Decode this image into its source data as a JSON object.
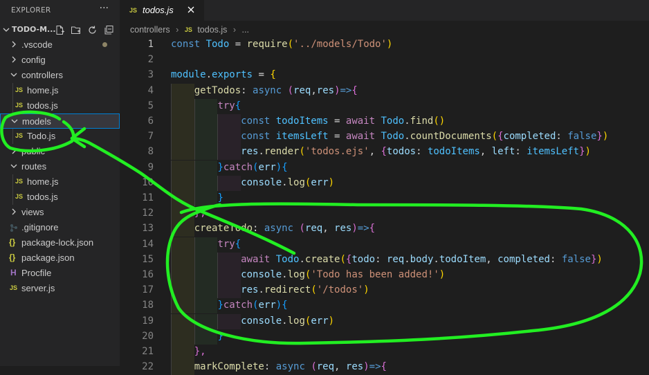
{
  "sidebar": {
    "title": "EXPLORER",
    "more_glyph": "···",
    "workspace": "TODO-M...",
    "tree": [
      {
        "label": ".vscode",
        "kind": "folder",
        "expanded": false,
        "modified_dot": true
      },
      {
        "label": "config",
        "kind": "folder",
        "expanded": false
      },
      {
        "label": "controllers",
        "kind": "folder",
        "expanded": true
      },
      {
        "label": "home.js",
        "kind": "js"
      },
      {
        "label": "todos.js",
        "kind": "js"
      },
      {
        "label": "models",
        "kind": "folder",
        "expanded": true,
        "selected": true
      },
      {
        "label": "Todo.js",
        "kind": "js"
      },
      {
        "label": "public",
        "kind": "folder",
        "expanded": false
      },
      {
        "label": "routes",
        "kind": "folder",
        "expanded": true
      },
      {
        "label": "home.js",
        "kind": "js"
      },
      {
        "label": "todos.js",
        "kind": "js"
      },
      {
        "label": "views",
        "kind": "folder",
        "expanded": false
      },
      {
        "label": ".gitignore",
        "kind": "gitignore"
      },
      {
        "label": "package-lock.json",
        "kind": "json"
      },
      {
        "label": "package.json",
        "kind": "json"
      },
      {
        "label": "Procfile",
        "kind": "procfile"
      },
      {
        "label": "server.js",
        "kind": "js"
      }
    ]
  },
  "editor": {
    "tab": {
      "icon_text": "JS",
      "label": "todos.js"
    },
    "breadcrumb": {
      "folder": "controllers",
      "file": "todos.js",
      "tail": "..."
    },
    "lines": [
      {
        "n": "1",
        "tokens": [
          [
            "const ",
            "kw"
          ],
          [
            "Todo",
            "var"
          ],
          [
            " = ",
            "pl"
          ],
          [
            "require",
            "fn"
          ],
          [
            "(",
            "br1"
          ],
          [
            "'../models/Todo'",
            "str"
          ],
          [
            ")",
            "br1"
          ]
        ]
      },
      {
        "n": "2",
        "tokens": []
      },
      {
        "n": "3",
        "tokens": [
          [
            "module",
            "var"
          ],
          [
            ".",
            "pl"
          ],
          [
            "exports",
            "var"
          ],
          [
            " = ",
            "pl"
          ],
          [
            "{",
            "br1"
          ]
        ]
      },
      {
        "n": "4",
        "tokens": [
          [
            "    ",
            "pl"
          ],
          [
            "getTodos",
            "fn"
          ],
          [
            ": ",
            "pl"
          ],
          [
            "async ",
            "kw"
          ],
          [
            "(",
            "br2"
          ],
          [
            "req",
            "prop"
          ],
          [
            ",",
            "pl"
          ],
          [
            "res",
            "prop"
          ],
          [
            ")",
            "br2"
          ],
          [
            "=>",
            "kw"
          ],
          [
            "{",
            "br2"
          ]
        ]
      },
      {
        "n": "5",
        "tokens": [
          [
            "        ",
            "pl"
          ],
          [
            "try",
            "ctl"
          ],
          [
            "{",
            "br3"
          ]
        ]
      },
      {
        "n": "6",
        "tokens": [
          [
            "            ",
            "pl"
          ],
          [
            "const ",
            "kw"
          ],
          [
            "todoItems",
            "var"
          ],
          [
            " = ",
            "pl"
          ],
          [
            "await ",
            "ctl"
          ],
          [
            "Todo",
            "var"
          ],
          [
            ".",
            "pl"
          ],
          [
            "find",
            "fn"
          ],
          [
            "()",
            "br1"
          ]
        ]
      },
      {
        "n": "7",
        "tokens": [
          [
            "            ",
            "pl"
          ],
          [
            "const ",
            "kw"
          ],
          [
            "itemsLeft",
            "var"
          ],
          [
            " = ",
            "pl"
          ],
          [
            "await ",
            "ctl"
          ],
          [
            "Todo",
            "var"
          ],
          [
            ".",
            "pl"
          ],
          [
            "countDocuments",
            "fn"
          ],
          [
            "(",
            "br1"
          ],
          [
            "{",
            "br2"
          ],
          [
            "completed",
            "prop"
          ],
          [
            ": ",
            "pl"
          ],
          [
            "false",
            "kw"
          ],
          [
            "}",
            "br2"
          ],
          [
            ")",
            "br1"
          ]
        ]
      },
      {
        "n": "8",
        "tokens": [
          [
            "            ",
            "pl"
          ],
          [
            "res",
            "prop"
          ],
          [
            ".",
            "pl"
          ],
          [
            "render",
            "fn"
          ],
          [
            "(",
            "br1"
          ],
          [
            "'todos.ejs'",
            "str"
          ],
          [
            ", ",
            "pl"
          ],
          [
            "{",
            "br2"
          ],
          [
            "todos",
            "prop"
          ],
          [
            ": ",
            "pl"
          ],
          [
            "todoItems",
            "var"
          ],
          [
            ", ",
            "pl"
          ],
          [
            "left",
            "prop"
          ],
          [
            ": ",
            "pl"
          ],
          [
            "itemsLeft",
            "var"
          ],
          [
            "}",
            "br2"
          ],
          [
            ")",
            "br1"
          ]
        ]
      },
      {
        "n": "9",
        "tokens": [
          [
            "        ",
            "pl"
          ],
          [
            "}",
            "br3"
          ],
          [
            "catch",
            "ctl"
          ],
          [
            "(",
            "br3"
          ],
          [
            "err",
            "prop"
          ],
          [
            ")",
            "br3"
          ],
          [
            "{",
            "br3"
          ]
        ]
      },
      {
        "n": "10",
        "tokens": [
          [
            "            ",
            "pl"
          ],
          [
            "console",
            "prop"
          ],
          [
            ".",
            "pl"
          ],
          [
            "log",
            "fn"
          ],
          [
            "(",
            "br1"
          ],
          [
            "err",
            "prop"
          ],
          [
            ")",
            "br1"
          ]
        ]
      },
      {
        "n": "11",
        "tokens": [
          [
            "        ",
            "pl"
          ],
          [
            "}",
            "br3"
          ]
        ]
      },
      {
        "n": "12",
        "tokens": [
          [
            "    ",
            "pl"
          ],
          [
            "},",
            "br2"
          ]
        ]
      },
      {
        "n": "13",
        "tokens": [
          [
            "    ",
            "pl"
          ],
          [
            "createTodo",
            "fn"
          ],
          [
            ": ",
            "pl"
          ],
          [
            "async ",
            "kw"
          ],
          [
            "(",
            "br2"
          ],
          [
            "req",
            "prop"
          ],
          [
            ", ",
            "pl"
          ],
          [
            "res",
            "prop"
          ],
          [
            ")",
            "br2"
          ],
          [
            "=>",
            "kw"
          ],
          [
            "{",
            "br2"
          ]
        ]
      },
      {
        "n": "14",
        "tokens": [
          [
            "        ",
            "pl"
          ],
          [
            "try",
            "ctl"
          ],
          [
            "{",
            "br3"
          ]
        ]
      },
      {
        "n": "15",
        "tokens": [
          [
            "            ",
            "pl"
          ],
          [
            "await ",
            "ctl"
          ],
          [
            "Todo",
            "var"
          ],
          [
            ".",
            "pl"
          ],
          [
            "create",
            "fn"
          ],
          [
            "(",
            "br1"
          ],
          [
            "{",
            "br2"
          ],
          [
            "todo",
            "prop"
          ],
          [
            ": ",
            "pl"
          ],
          [
            "req",
            "prop"
          ],
          [
            ".",
            "pl"
          ],
          [
            "body",
            "prop"
          ],
          [
            ".",
            "pl"
          ],
          [
            "todoItem",
            "prop"
          ],
          [
            ", ",
            "pl"
          ],
          [
            "completed",
            "prop"
          ],
          [
            ": ",
            "pl"
          ],
          [
            "false",
            "kw"
          ],
          [
            "}",
            "br2"
          ],
          [
            ")",
            "br1"
          ]
        ]
      },
      {
        "n": "16",
        "tokens": [
          [
            "            ",
            "pl"
          ],
          [
            "console",
            "prop"
          ],
          [
            ".",
            "pl"
          ],
          [
            "log",
            "fn"
          ],
          [
            "(",
            "br1"
          ],
          [
            "'Todo has been added!'",
            "str"
          ],
          [
            ")",
            "br1"
          ]
        ]
      },
      {
        "n": "17",
        "tokens": [
          [
            "            ",
            "pl"
          ],
          [
            "res",
            "prop"
          ],
          [
            ".",
            "pl"
          ],
          [
            "redirect",
            "fn"
          ],
          [
            "(",
            "br1"
          ],
          [
            "'/todos'",
            "str"
          ],
          [
            ")",
            "br1"
          ]
        ]
      },
      {
        "n": "18",
        "tokens": [
          [
            "        ",
            "pl"
          ],
          [
            "}",
            "br3"
          ],
          [
            "catch",
            "ctl"
          ],
          [
            "(",
            "br3"
          ],
          [
            "err",
            "prop"
          ],
          [
            ")",
            "br3"
          ],
          [
            "{",
            "br3"
          ]
        ]
      },
      {
        "n": "19",
        "tokens": [
          [
            "            ",
            "pl"
          ],
          [
            "console",
            "prop"
          ],
          [
            ".",
            "pl"
          ],
          [
            "log",
            "fn"
          ],
          [
            "(",
            "br1"
          ],
          [
            "err",
            "prop"
          ],
          [
            ")",
            "br1"
          ]
        ]
      },
      {
        "n": "20",
        "tokens": [
          [
            "        ",
            "pl"
          ],
          [
            "}",
            "br3"
          ]
        ]
      },
      {
        "n": "21",
        "tokens": [
          [
            "    ",
            "pl"
          ],
          [
            "},",
            "br2"
          ]
        ]
      },
      {
        "n": "22",
        "tokens": [
          [
            "    ",
            "pl"
          ],
          [
            "markComplete",
            "fn"
          ],
          [
            ": ",
            "pl"
          ],
          [
            "async ",
            "kw"
          ],
          [
            "(",
            "br2"
          ],
          [
            "req",
            "prop"
          ],
          [
            ", ",
            "pl"
          ],
          [
            "res",
            "prop"
          ],
          [
            ")",
            "br2"
          ],
          [
            "=>",
            "kw"
          ],
          [
            "{",
            "br2"
          ]
        ]
      }
    ]
  },
  "annotation_color": "#22ee22",
  "colors": {
    "background": "#1e1e1e",
    "sidebar": "#252526",
    "selection_border": "#007fd4",
    "js_icon": "#cbcb41"
  }
}
